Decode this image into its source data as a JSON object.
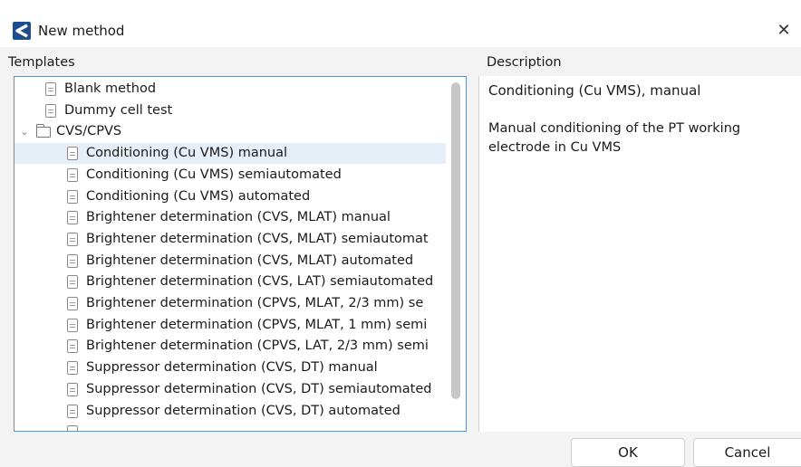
{
  "window": {
    "title": "New method",
    "close_glyph": "✕",
    "app_icon": "app-logo-icon"
  },
  "labels": {
    "templates": "Templates",
    "description": "Description"
  },
  "tree": {
    "items": [
      {
        "label": "Blank method",
        "icon": "document-icon",
        "level": 1
      },
      {
        "label": "Dummy cell test",
        "icon": "document-icon",
        "level": 1
      },
      {
        "label": "CVS/CPVS",
        "icon": "folder-open-icon",
        "level": 0,
        "expanded": true
      },
      {
        "label": "Conditioning (Cu VMS) manual",
        "icon": "document-icon",
        "level": 2,
        "selected": true
      },
      {
        "label": "Conditioning (Cu VMS) semiautomated",
        "icon": "document-icon",
        "level": 2
      },
      {
        "label": "Conditioning (Cu VMS) automated",
        "icon": "document-icon",
        "level": 2
      },
      {
        "label": "Brightener determination (CVS, MLAT) manual",
        "icon": "document-icon",
        "level": 2
      },
      {
        "label": "Brightener determination (CVS, MLAT) semiautomat",
        "icon": "document-icon",
        "level": 2
      },
      {
        "label": "Brightener determination (CVS, MLAT) automated",
        "icon": "document-icon",
        "level": 2
      },
      {
        "label": "Brightener determination (CVS, LAT) semiautomated",
        "icon": "document-icon",
        "level": 2
      },
      {
        "label": "Brightener determination (CPVS, MLAT, 2/3 mm) se",
        "icon": "document-icon",
        "level": 2
      },
      {
        "label": "Brightener determination (CPVS, MLAT, 1 mm) semi",
        "icon": "document-icon",
        "level": 2
      },
      {
        "label": "Brightener determination (CPVS, LAT, 2/3 mm) semi",
        "icon": "document-icon",
        "level": 2
      },
      {
        "label": "Suppressor determination (CVS, DT) manual",
        "icon": "document-icon",
        "level": 2
      },
      {
        "label": "Suppressor determination (CVS, DT) semiautomated",
        "icon": "document-icon",
        "level": 2
      },
      {
        "label": "Suppressor determination (CVS, DT) automated",
        "icon": "document-icon",
        "level": 2
      },
      {
        "label": "",
        "icon": "document-icon",
        "level": 2
      }
    ]
  },
  "description": {
    "title": "Conditioning (Cu VMS), manual",
    "text": "Manual conditioning of the PT working electrode in Cu VMS"
  },
  "buttons": {
    "ok": "OK",
    "cancel": "Cancel"
  },
  "colors": {
    "selection": "#e6eef8",
    "tree_border": "#6a8fb3",
    "app_icon": "#1e4d8c"
  }
}
